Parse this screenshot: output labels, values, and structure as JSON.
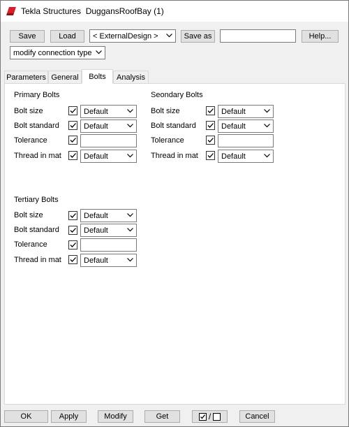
{
  "window": {
    "title": "Tekla Structures  DuggansRoofBay (1)"
  },
  "toolbar": {
    "save_label": "Save",
    "load_label": "Load",
    "preset_value": "< ExternalDesign >",
    "save_as_label": "Save as",
    "save_as_value": "",
    "help_label": "Help...",
    "mode_value": "modify connection type"
  },
  "tabs": [
    {
      "label": "Parameters"
    },
    {
      "label": "General"
    },
    {
      "label": "Bolts"
    },
    {
      "label": "Analysis"
    }
  ],
  "active_tab": "Bolts",
  "bolt_groups": {
    "primary": {
      "title": "Primary Bolts",
      "rows": [
        {
          "label": "Bolt size",
          "checked": true,
          "value": "Default"
        },
        {
          "label": "Bolt standard",
          "checked": true,
          "value": "Default"
        },
        {
          "label": "Tolerance",
          "checked": true,
          "value": ""
        },
        {
          "label": "Thread in mat",
          "checked": true,
          "value": "Default"
        }
      ]
    },
    "secondary": {
      "title": "Seondary Bolts",
      "rows": [
        {
          "label": "Bolt size",
          "checked": true,
          "value": "Default"
        },
        {
          "label": "Bolt standard",
          "checked": true,
          "value": "Default"
        },
        {
          "label": "Tolerance",
          "checked": true,
          "value": ""
        },
        {
          "label": "Thread in mat",
          "checked": true,
          "value": "Default"
        }
      ]
    },
    "tertiary": {
      "title": "Tertiary Bolts",
      "rows": [
        {
          "label": "Bolt size",
          "checked": true,
          "value": "Default"
        },
        {
          "label": "Bolt standard",
          "checked": true,
          "value": "Default"
        },
        {
          "label": "Tolerance",
          "checked": true,
          "value": ""
        },
        {
          "label": "Thread in mat",
          "checked": true,
          "value": "Default"
        }
      ]
    }
  },
  "footer": {
    "ok_label": "OK",
    "apply_label": "Apply",
    "modify_label": "Modify",
    "get_label": "Get",
    "toggle_separator": "/",
    "cancel_label": "Cancel"
  },
  "icons": {
    "app": "tekla-logo-icon",
    "dropdown": "chevron-down-icon",
    "checkbox": "checkmark-icon"
  },
  "colors": {
    "app_icon": "#d4202a",
    "panel_bg": "#ffffff",
    "window_bg": "#f0f0f0",
    "button_bg": "#e1e1e1"
  }
}
